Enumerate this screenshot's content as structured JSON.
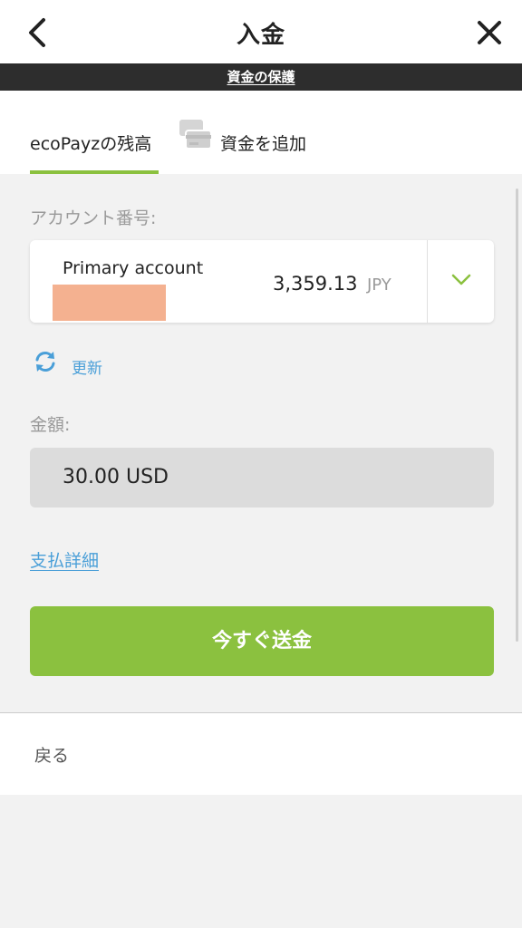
{
  "header": {
    "title": "入金",
    "back_icon": "chevron-left-icon",
    "close_icon": "close-icon"
  },
  "protection_bar": {
    "link_label": "資金の保護"
  },
  "tabs": {
    "balance_label": "ecoPayzの残高",
    "add_funds_label": "資金を追加",
    "add_funds_icon": "card-icon",
    "active": "balance"
  },
  "account": {
    "label": "アカウント番号:",
    "name": "Primary account",
    "balance": "3,359.13",
    "currency": "JPY",
    "chevron_icon": "chevron-down-icon"
  },
  "refresh": {
    "label": "更新",
    "icon": "refresh-icon"
  },
  "amount": {
    "label": "金額:",
    "value": "30.00 USD"
  },
  "payment_details_link": "支払詳細",
  "send_button_label": "今すぐ送金",
  "footer": {
    "back_label": "戻る"
  },
  "colors": {
    "accent_green": "#8bc13f",
    "link_blue": "#4a9fd8",
    "dark_bar": "#2d2d2d",
    "redaction": "#f4b190"
  }
}
